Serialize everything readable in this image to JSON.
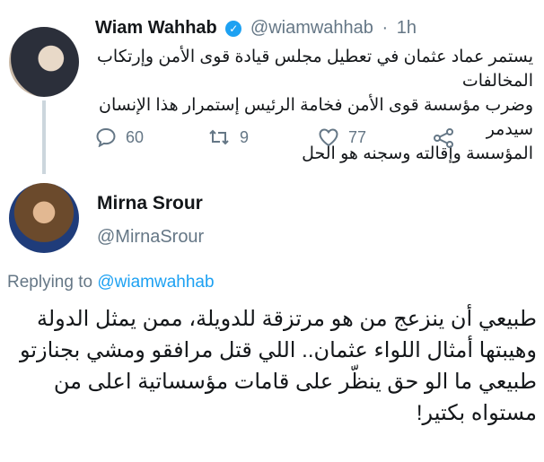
{
  "tweet": {
    "author_name": "Wiam Wahhab",
    "handle": "@wiamwahhab",
    "separator": "·",
    "time": "1h",
    "verified_mark": "✓",
    "lines": [
      "يستمر عماد عثمان في تعطيل مجلس قيادة قوى الأمن وإرتكاب المخالفات",
      "وضرب مؤسسة قوى الأمن فخامة الرئيس إستمرار هذا الإنسان سيدمر",
      "المؤسسة وإقالته وسجنه هو الحل"
    ],
    "actions": {
      "replies": "60",
      "retweets": "9",
      "likes": "77"
    }
  },
  "reply": {
    "author_name": "Mirna Srour",
    "handle": "@MirnaSrour",
    "replying_prefix": "Replying to",
    "replying_to": "@wiamwahhab",
    "lines": [
      "طبيعي أن ينزعج من هو مرتزقة للدويلة، ممن يمثل الدولة",
      "وهيبتها أمثال اللواء عثمان.. اللي قتل مرافقو ومشي بجنازتو",
      "طبيعي ما الو حق ينظّر على قامات مؤسساتية اعلى من",
      "مستواه بكتير!"
    ]
  },
  "colors": {
    "accent": "#1da1f2",
    "secondary_text": "#657786",
    "primary_text": "#14171a",
    "thread_line": "#ccd6dd"
  },
  "icons": [
    "reply-icon",
    "retweet-icon",
    "like-icon",
    "share-icon",
    "verified-icon"
  ]
}
